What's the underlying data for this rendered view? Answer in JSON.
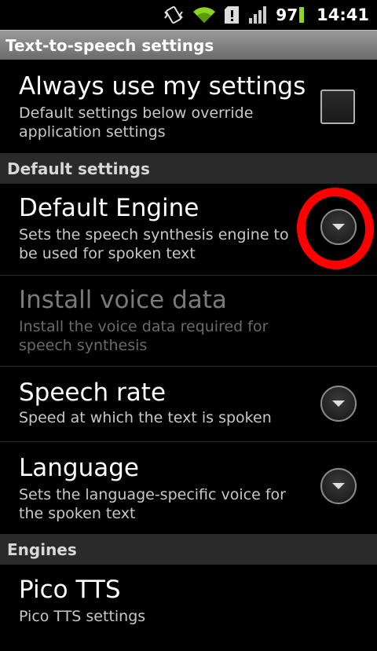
{
  "status_bar": {
    "icons": [
      "vibrate-icon",
      "wifi-icon",
      "sd-card-alert-icon",
      "signal-icon"
    ],
    "battery": "97",
    "time": "14:41"
  },
  "title": "Text-to-speech settings",
  "always_use": {
    "title": "Always use my settings",
    "summary": "Default settings below override application settings",
    "checked": false
  },
  "default_category": "Default settings",
  "default_engine": {
    "title": "Default Engine",
    "summary": "Sets the speech synthesis engine to be used for spoken text"
  },
  "install_voice": {
    "title": "Install voice data",
    "summary": "Install the voice data required for speech synthesis"
  },
  "speech_rate": {
    "title": "Speech rate",
    "summary": "Speed at which the text is spoken"
  },
  "language": {
    "title": "Language",
    "summary": "Sets the language-specific voice for the spoken text"
  },
  "engines_category": "Engines",
  "pico": {
    "title": "Pico TTS",
    "summary": "Pico TTS settings"
  },
  "colors": {
    "highlight": "#ff0000",
    "battery": "#8bd61e"
  }
}
